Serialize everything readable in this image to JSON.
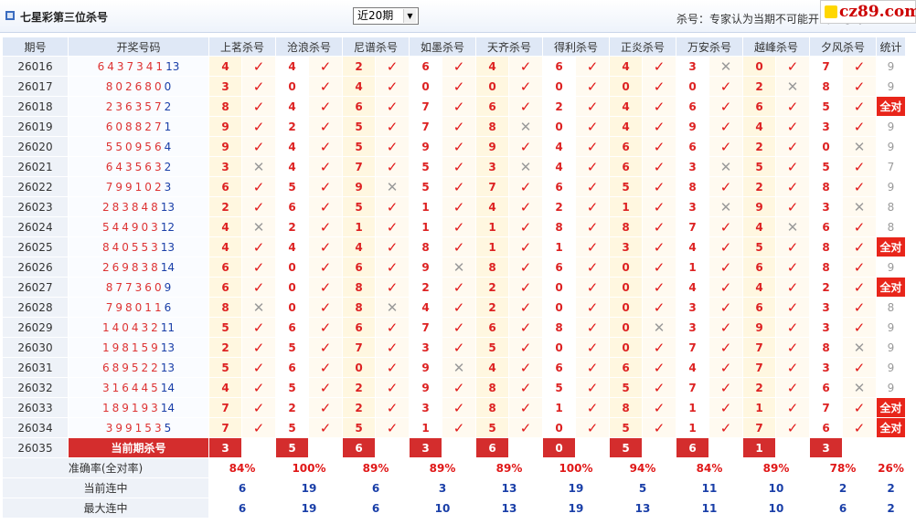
{
  "header": {
    "title": "七星彩第三位杀号",
    "period_select": "近20期",
    "note": "杀号：专家认为当期不可能开出的号码",
    "logo": "cz89.com"
  },
  "columns": {
    "issue": "期号",
    "draw": "开奖号码",
    "experts": [
      "上茗杀号",
      "沧浪杀号",
      "尼谱杀号",
      "如墨杀号",
      "天齐杀号",
      "得利杀号",
      "正炎杀号",
      "万安杀号",
      "越峰杀号",
      "夕风杀号"
    ],
    "stat": "统计"
  },
  "rows": [
    {
      "issue": "26016",
      "digits": "6437341",
      "sum": "13",
      "kills": [
        "4",
        "4",
        "2",
        "6",
        "4",
        "6",
        "4",
        "3",
        "0",
        "7"
      ],
      "marks": [
        "y",
        "y",
        "y",
        "y",
        "y",
        "y",
        "y",
        "n",
        "y",
        "y"
      ],
      "stat": "9"
    },
    {
      "issue": "26017",
      "digits": "802680",
      "sum": "0",
      "kills": [
        "3",
        "0",
        "4",
        "0",
        "0",
        "0",
        "0",
        "0",
        "2",
        "8"
      ],
      "marks": [
        "y",
        "y",
        "y",
        "y",
        "y",
        "y",
        "y",
        "y",
        "n",
        "y"
      ],
      "stat": "9"
    },
    {
      "issue": "26018",
      "digits": "236357",
      "sum": "2",
      "kills": [
        "8",
        "4",
        "6",
        "7",
        "6",
        "2",
        "4",
        "6",
        "6",
        "5"
      ],
      "marks": [
        "y",
        "y",
        "y",
        "y",
        "y",
        "y",
        "y",
        "y",
        "y",
        "y"
      ],
      "stat": "全对"
    },
    {
      "issue": "26019",
      "digits": "608827",
      "sum": "1",
      "kills": [
        "9",
        "2",
        "5",
        "7",
        "8",
        "0",
        "4",
        "9",
        "4",
        "3"
      ],
      "marks": [
        "y",
        "y",
        "y",
        "y",
        "n",
        "y",
        "y",
        "y",
        "y",
        "y"
      ],
      "stat": "9"
    },
    {
      "issue": "26020",
      "digits": "550956",
      "sum": "4",
      "kills": [
        "9",
        "4",
        "5",
        "9",
        "9",
        "4",
        "6",
        "6",
        "2",
        "0"
      ],
      "marks": [
        "y",
        "y",
        "y",
        "y",
        "y",
        "y",
        "y",
        "y",
        "y",
        "n"
      ],
      "stat": "9"
    },
    {
      "issue": "26021",
      "digits": "643563",
      "sum": "2",
      "kills": [
        "3",
        "4",
        "7",
        "5",
        "3",
        "4",
        "6",
        "3",
        "5",
        "5"
      ],
      "marks": [
        "n",
        "y",
        "y",
        "y",
        "n",
        "y",
        "y",
        "n",
        "y",
        "y"
      ],
      "stat": "7"
    },
    {
      "issue": "26022",
      "digits": "799102",
      "sum": "3",
      "kills": [
        "6",
        "5",
        "9",
        "5",
        "7",
        "6",
        "5",
        "8",
        "2",
        "8"
      ],
      "marks": [
        "y",
        "y",
        "n",
        "y",
        "y",
        "y",
        "y",
        "y",
        "y",
        "y"
      ],
      "stat": "9"
    },
    {
      "issue": "26023",
      "digits": "283848",
      "sum": "13",
      "kills": [
        "2",
        "6",
        "5",
        "1",
        "4",
        "2",
        "1",
        "3",
        "9",
        "3"
      ],
      "marks": [
        "y",
        "y",
        "y",
        "y",
        "y",
        "y",
        "y",
        "n",
        "y",
        "n"
      ],
      "stat": "8"
    },
    {
      "issue": "26024",
      "digits": "544903",
      "sum": "12",
      "kills": [
        "4",
        "2",
        "1",
        "1",
        "1",
        "8",
        "8",
        "7",
        "4",
        "6"
      ],
      "marks": [
        "n",
        "y",
        "y",
        "y",
        "y",
        "y",
        "y",
        "y",
        "n",
        "y"
      ],
      "stat": "8"
    },
    {
      "issue": "26025",
      "digits": "840553",
      "sum": "13",
      "kills": [
        "4",
        "4",
        "4",
        "8",
        "1",
        "1",
        "3",
        "4",
        "5",
        "8"
      ],
      "marks": [
        "y",
        "y",
        "y",
        "y",
        "y",
        "y",
        "y",
        "y",
        "y",
        "y"
      ],
      "stat": "全对"
    },
    {
      "issue": "26026",
      "digits": "269838",
      "sum": "14",
      "kills": [
        "6",
        "0",
        "6",
        "9",
        "8",
        "6",
        "0",
        "1",
        "6",
        "8"
      ],
      "marks": [
        "y",
        "y",
        "y",
        "n",
        "y",
        "y",
        "y",
        "y",
        "y",
        "y"
      ],
      "stat": "9"
    },
    {
      "issue": "26027",
      "digits": "877360",
      "sum": "9",
      "kills": [
        "6",
        "0",
        "8",
        "2",
        "2",
        "0",
        "0",
        "4",
        "4",
        "2"
      ],
      "marks": [
        "y",
        "y",
        "y",
        "y",
        "y",
        "y",
        "y",
        "y",
        "y",
        "y"
      ],
      "stat": "全对"
    },
    {
      "issue": "26028",
      "digits": "798011",
      "sum": "6",
      "kills": [
        "8",
        "0",
        "8",
        "4",
        "2",
        "0",
        "0",
        "3",
        "6",
        "3"
      ],
      "marks": [
        "n",
        "y",
        "n",
        "y",
        "y",
        "y",
        "y",
        "y",
        "y",
        "y"
      ],
      "stat": "8"
    },
    {
      "issue": "26029",
      "digits": "140432",
      "sum": "11",
      "kills": [
        "5",
        "6",
        "6",
        "7",
        "6",
        "8",
        "0",
        "3",
        "9",
        "3"
      ],
      "marks": [
        "y",
        "y",
        "y",
        "y",
        "y",
        "y",
        "n",
        "y",
        "y",
        "y"
      ],
      "stat": "9"
    },
    {
      "issue": "26030",
      "digits": "198159",
      "sum": "13",
      "kills": [
        "2",
        "5",
        "7",
        "3",
        "5",
        "0",
        "0",
        "7",
        "7",
        "8"
      ],
      "marks": [
        "y",
        "y",
        "y",
        "y",
        "y",
        "y",
        "y",
        "y",
        "y",
        "n"
      ],
      "stat": "9"
    },
    {
      "issue": "26031",
      "digits": "689522",
      "sum": "13",
      "kills": [
        "5",
        "6",
        "0",
        "9",
        "4",
        "6",
        "6",
        "4",
        "7",
        "3"
      ],
      "marks": [
        "y",
        "y",
        "y",
        "n",
        "y",
        "y",
        "y",
        "y",
        "y",
        "y"
      ],
      "stat": "9"
    },
    {
      "issue": "26032",
      "digits": "316445",
      "sum": "14",
      "kills": [
        "4",
        "5",
        "2",
        "9",
        "8",
        "5",
        "5",
        "7",
        "2",
        "6"
      ],
      "marks": [
        "y",
        "y",
        "y",
        "y",
        "y",
        "y",
        "y",
        "y",
        "y",
        "n"
      ],
      "stat": "9"
    },
    {
      "issue": "26033",
      "digits": "189193",
      "sum": "14",
      "kills": [
        "7",
        "2",
        "2",
        "3",
        "8",
        "1",
        "8",
        "1",
        "1",
        "7"
      ],
      "marks": [
        "y",
        "y",
        "y",
        "y",
        "y",
        "y",
        "y",
        "y",
        "y",
        "y"
      ],
      "stat": "全对"
    },
    {
      "issue": "26034",
      "digits": "399153",
      "sum": "5",
      "kills": [
        "7",
        "5",
        "5",
        "1",
        "5",
        "0",
        "5",
        "1",
        "7",
        "6"
      ],
      "marks": [
        "y",
        "y",
        "y",
        "y",
        "y",
        "y",
        "y",
        "y",
        "y",
        "y"
      ],
      "stat": "全对"
    }
  ],
  "current": {
    "issue": "26035",
    "label": "当前期杀号",
    "kills": [
      "3",
      "5",
      "6",
      "3",
      "6",
      "0",
      "5",
      "6",
      "1",
      "3"
    ]
  },
  "footer": {
    "accuracy_label": "准确率(全对率)",
    "accuracy": [
      "84%",
      "100%",
      "89%",
      "89%",
      "89%",
      "100%",
      "94%",
      "84%",
      "89%",
      "78%"
    ],
    "accuracy_total": "26%",
    "current_streak_label": "当前连中",
    "current_streak": [
      "6",
      "19",
      "6",
      "3",
      "13",
      "19",
      "5",
      "11",
      "10",
      "2"
    ],
    "current_streak_total": "2",
    "max_streak_label": "最大连中",
    "max_streak": [
      "6",
      "19",
      "6",
      "10",
      "13",
      "19",
      "13",
      "11",
      "10",
      "6"
    ],
    "max_streak_total": "2"
  },
  "marks_legend": {
    "y": "✓",
    "n": "✕"
  }
}
